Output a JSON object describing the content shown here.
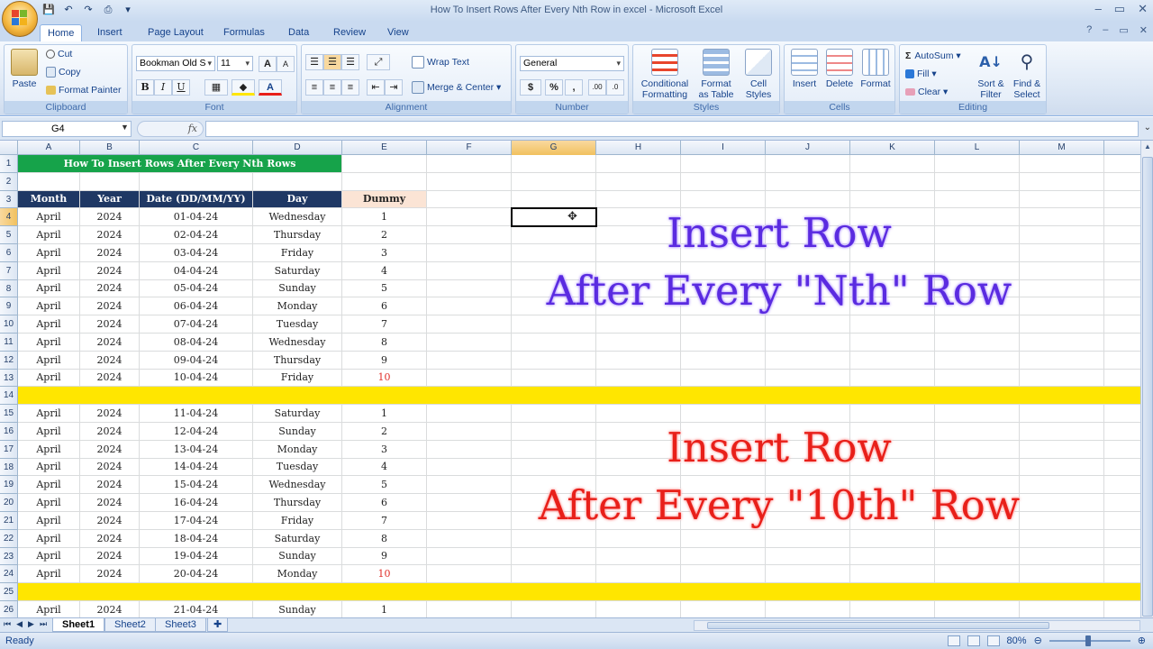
{
  "window": {
    "title": "How To Insert Rows After Every Nth Row in excel - Microsoft Excel",
    "minimize": "–",
    "maximize": "▭",
    "close": "✕"
  },
  "ribbon_tabs": [
    "Home",
    "Insert",
    "Page Layout",
    "Formulas",
    "Data",
    "Review",
    "View"
  ],
  "ribbon": {
    "clipboard": {
      "label": "Clipboard",
      "paste": "Paste",
      "cut": "Cut",
      "copy": "Copy",
      "format_painter": "Format Painter"
    },
    "font": {
      "label": "Font",
      "font_name": "Bookman Old S",
      "font_size": "11",
      "bold": "B",
      "italic": "I",
      "underline": "U",
      "grow": "A",
      "shrink": "A"
    },
    "alignment": {
      "label": "Alignment",
      "wrap_text": "Wrap Text",
      "merge_center": "Merge & Center"
    },
    "number": {
      "label": "Number",
      "format": "General",
      "currency": "$",
      "percent": "%",
      "comma": ",",
      "inc_decimal": ".00",
      "dec_decimal": ".0"
    },
    "styles": {
      "label": "Styles",
      "conditional": "Conditional",
      "conditional2": "Formatting",
      "format_table": "Format",
      "format_table2": "as Table",
      "cell_styles": "Cell",
      "cell_styles2": "Styles"
    },
    "cells": {
      "label": "Cells",
      "insert": "Insert",
      "delete": "Delete",
      "format": "Format"
    },
    "editing": {
      "label": "Editing",
      "autosum": "AutoSum",
      "fill": "Fill",
      "clear": "Clear",
      "sort": "Sort &",
      "sort2": "Filter",
      "find": "Find &",
      "find2": "Select"
    }
  },
  "formula_bar": {
    "name_box": "G4",
    "fx": "fx",
    "formula": ""
  },
  "columns": [
    "A",
    "B",
    "C",
    "D",
    "E",
    "F",
    "G",
    "H",
    "I",
    "J",
    "K",
    "L",
    "M"
  ],
  "selected_column": "G",
  "selected_row": 4,
  "sheet": {
    "title": "How To Insert Rows After Every Nth Rows",
    "headers": [
      "Month",
      "Year",
      "Date (DD/MM/YY)",
      "Day",
      "Dummy"
    ],
    "rows": [
      {
        "n": 4,
        "cells": [
          "April",
          "2024",
          "01-04-24",
          "Wednesday",
          "1"
        ]
      },
      {
        "n": 5,
        "cells": [
          "April",
          "2024",
          "02-04-24",
          "Thursday",
          "2"
        ]
      },
      {
        "n": 6,
        "cells": [
          "April",
          "2024",
          "03-04-24",
          "Friday",
          "3"
        ]
      },
      {
        "n": 7,
        "cells": [
          "April",
          "2024",
          "04-04-24",
          "Saturday",
          "4"
        ]
      },
      {
        "n": 8,
        "cells": [
          "April",
          "2024",
          "05-04-24",
          "Sunday",
          "5"
        ]
      },
      {
        "n": 9,
        "cells": [
          "April",
          "2024",
          "06-04-24",
          "Monday",
          "6"
        ]
      },
      {
        "n": 10,
        "cells": [
          "April",
          "2024",
          "07-04-24",
          "Tuesday",
          "7"
        ]
      },
      {
        "n": 11,
        "cells": [
          "April",
          "2024",
          "08-04-24",
          "Wednesday",
          "8"
        ]
      },
      {
        "n": 12,
        "cells": [
          "April",
          "2024",
          "09-04-24",
          "Thursday",
          "9"
        ]
      },
      {
        "n": 13,
        "cells": [
          "April",
          "2024",
          "10-04-24",
          "Friday",
          "10"
        ]
      },
      {
        "n": 14,
        "yellow": true,
        "cells": []
      },
      {
        "n": 15,
        "cells": [
          "April",
          "2024",
          "11-04-24",
          "Saturday",
          "1"
        ]
      },
      {
        "n": 16,
        "cells": [
          "April",
          "2024",
          "12-04-24",
          "Sunday",
          "2"
        ]
      },
      {
        "n": 17,
        "cells": [
          "April",
          "2024",
          "13-04-24",
          "Monday",
          "3"
        ]
      },
      {
        "n": 18,
        "cells": [
          "April",
          "2024",
          "14-04-24",
          "Tuesday",
          "4"
        ]
      },
      {
        "n": 19,
        "cells": [
          "April",
          "2024",
          "15-04-24",
          "Wednesday",
          "5"
        ]
      },
      {
        "n": 20,
        "cells": [
          "April",
          "2024",
          "16-04-24",
          "Thursday",
          "6"
        ]
      },
      {
        "n": 21,
        "cells": [
          "April",
          "2024",
          "17-04-24",
          "Friday",
          "7"
        ]
      },
      {
        "n": 22,
        "cells": [
          "April",
          "2024",
          "18-04-24",
          "Saturday",
          "8"
        ]
      },
      {
        "n": 23,
        "cells": [
          "April",
          "2024",
          "19-04-24",
          "Sunday",
          "9"
        ]
      },
      {
        "n": 24,
        "cells": [
          "April",
          "2024",
          "20-04-24",
          "Monday",
          "10"
        ]
      },
      {
        "n": 25,
        "yellow": true,
        "cells": []
      },
      {
        "n": 26,
        "cells": [
          "April",
          "2024",
          "21-04-24",
          "Sunday",
          "1"
        ]
      }
    ]
  },
  "overlay": {
    "line1": "Insert Row",
    "line2": "After Every \"Nth\" Row",
    "line3": "Insert Row",
    "line4": "After Every \"10th\" Row",
    "colors": {
      "purple": "#5a2be0",
      "red": "#e8201a"
    }
  },
  "sheet_tabs": [
    "Sheet1",
    "Sheet2",
    "Sheet3"
  ],
  "status": {
    "text": "Ready",
    "zoom": "80%"
  },
  "colors": {
    "header_bg": "#1f3864",
    "title_bg": "#16a34a",
    "highlight_row": "#ffe600",
    "dummy_header": "#fbe4d5",
    "ten_value": "#e0302a"
  }
}
